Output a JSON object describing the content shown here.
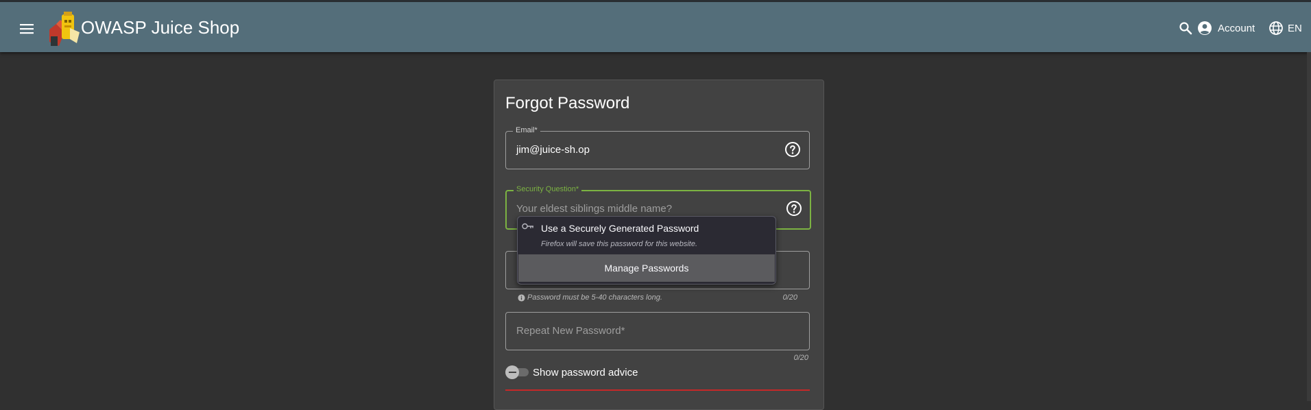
{
  "toolbar": {
    "title": "OWASP Juice Shop",
    "account_label": "Account",
    "language_label": "EN",
    "background_color": "#546e7a",
    "icons": [
      "menu-icon",
      "search-icon",
      "account-circle-icon",
      "globe-icon"
    ]
  },
  "form": {
    "title": "Forgot Password",
    "email": {
      "label": "Email*",
      "value": "jim@juice-sh.op"
    },
    "security_question": {
      "label": "Security Question*",
      "placeholder": "Your eldest siblings middle name?",
      "focus_color": "#7cb342"
    },
    "new_password": {
      "hint": "Password must be 5-40 characters long.",
      "counter": "0/20"
    },
    "repeat_password": {
      "placeholder": "Repeat New Password*",
      "counter": "0/20"
    },
    "show_advice_label": "Show password advice",
    "error_color": "#c62828"
  },
  "autofill_popup": {
    "item_title": "Use a Securely Generated Password",
    "item_subtitle": "Firefox will save this password for this website.",
    "footer_label": "Manage Passwords"
  }
}
